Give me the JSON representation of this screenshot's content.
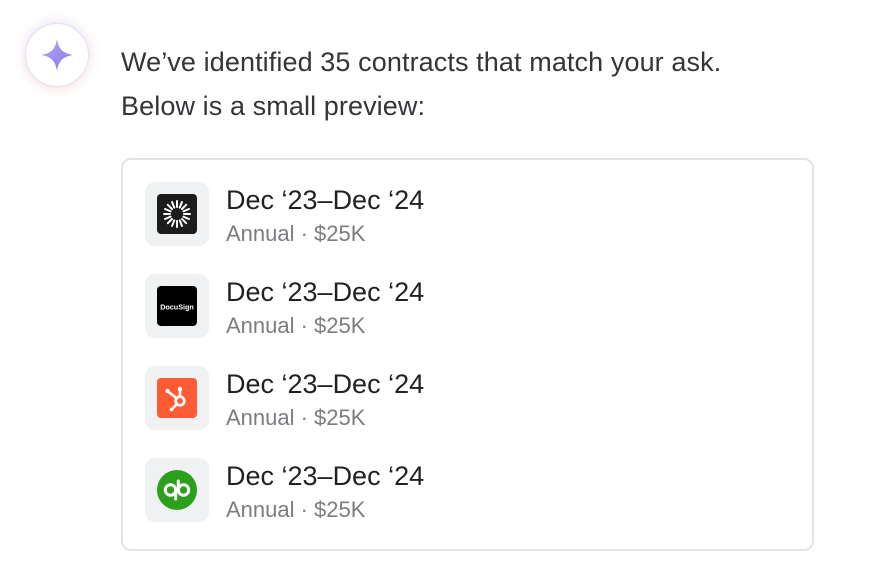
{
  "assistant": {
    "avatar_icon": "sparkle-icon",
    "accent_colors": [
      "#8f82ee",
      "#c6b8f7"
    ],
    "message_line1": "We’ve identified 35 contracts that match your ask.",
    "message_line2": "Below is a small preview:"
  },
  "contracts": [
    {
      "logo": "sunburst-logo-icon",
      "logo_bg": "#1c1c1c",
      "period": "Dec ‘23–Dec ‘24",
      "details": "Annual · $25K"
    },
    {
      "logo": "docusign-logo-icon",
      "logo_text": "DocuSign",
      "logo_bg": "#000000",
      "period": "Dec ‘23–Dec ‘24",
      "details": "Annual · $25K"
    },
    {
      "logo": "hubspot-logo-icon",
      "logo_bg": "#ff5c35",
      "period": "Dec ‘23–Dec ‘24",
      "details": "Annual · $25K"
    },
    {
      "logo": "quickbooks-logo-icon",
      "logo_bg": "#2ca01c",
      "period": "Dec ‘23–Dec ‘24",
      "details": "Annual · $25K"
    }
  ]
}
